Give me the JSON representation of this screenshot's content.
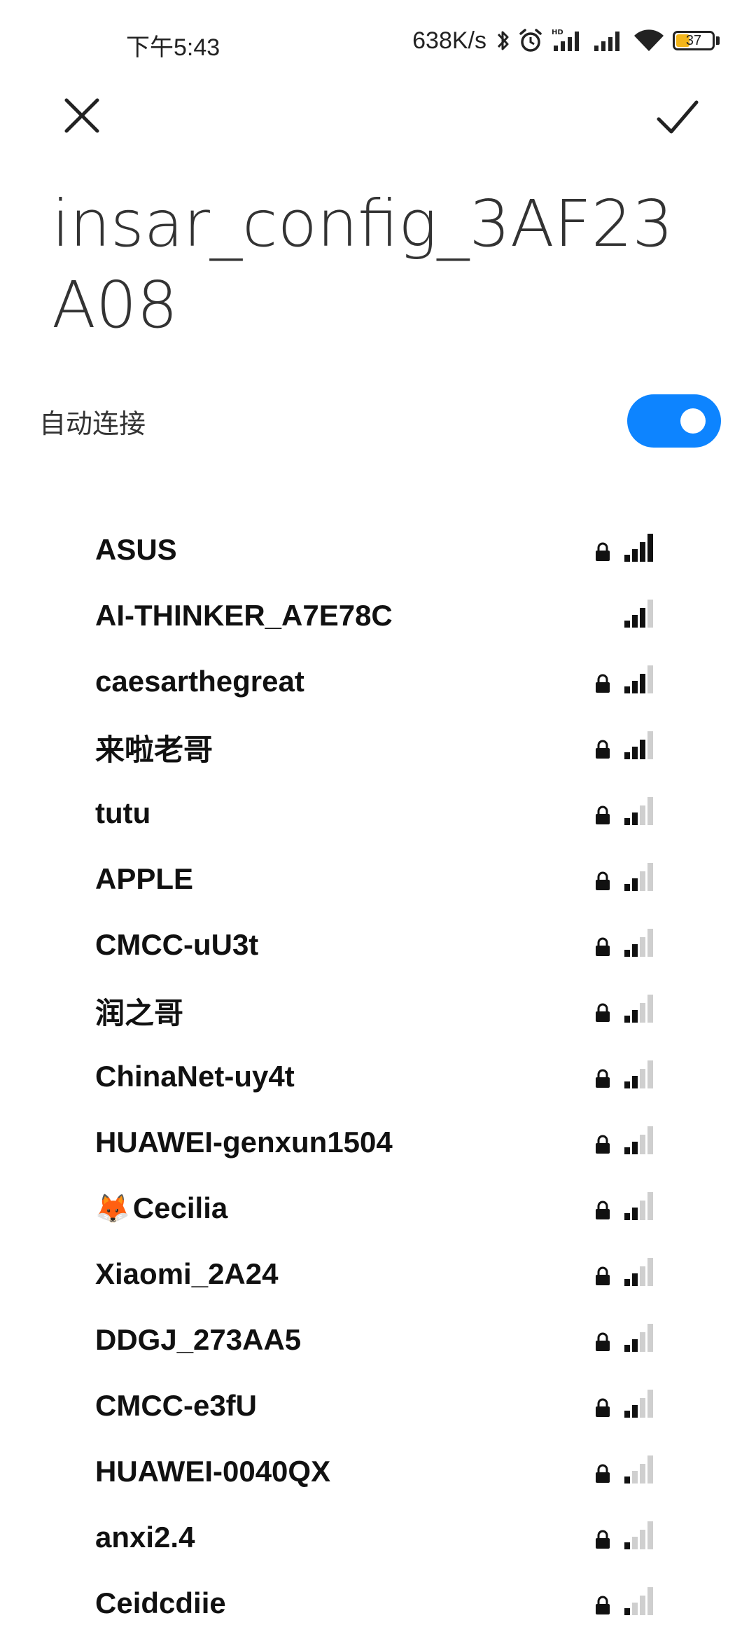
{
  "status_bar": {
    "time": "下午5:43",
    "net_speed": "638K/s",
    "battery_level": "37",
    "battery_fraction": 0.37,
    "battery_color": "#f3b51a"
  },
  "header": {
    "close_icon": "close-icon",
    "confirm_icon": "check-icon",
    "title": "insar_config_3AF23A08"
  },
  "auto_connect": {
    "label": "自动连接",
    "enabled": true,
    "accent": "#0d84ff"
  },
  "networks": [
    {
      "name": "ASUS",
      "secured": true,
      "bars": 4
    },
    {
      "name": "AI-THINKER_A7E78C",
      "secured": false,
      "bars": 3
    },
    {
      "name": "caesarthegreat",
      "secured": true,
      "bars": 3
    },
    {
      "name": "来啦老哥",
      "secured": true,
      "bars": 3
    },
    {
      "name": "tutu",
      "secured": true,
      "bars": 2
    },
    {
      "name": "APPLE",
      "secured": true,
      "bars": 2
    },
    {
      "name": "CMCC-uU3t",
      "secured": true,
      "bars": 2
    },
    {
      "name": "润之哥",
      "secured": true,
      "bars": 2
    },
    {
      "name": "ChinaNet-uy4t",
      "secured": true,
      "bars": 2
    },
    {
      "name": "HUAWEI-genxun1504",
      "secured": true,
      "bars": 2
    },
    {
      "name": "Cecilia",
      "secured": true,
      "bars": 2,
      "emoji": "🦊"
    },
    {
      "name": "Xiaomi_2A24",
      "secured": true,
      "bars": 2
    },
    {
      "name": "DDGJ_273AA5",
      "secured": true,
      "bars": 2
    },
    {
      "name": "CMCC-e3fU",
      "secured": true,
      "bars": 2
    },
    {
      "name": "HUAWEI-0040QX",
      "secured": true,
      "bars": 1
    },
    {
      "name": "anxi2.4",
      "secured": true,
      "bars": 1
    },
    {
      "name": "Ceidcdiie",
      "secured": true,
      "bars": 1
    }
  ]
}
